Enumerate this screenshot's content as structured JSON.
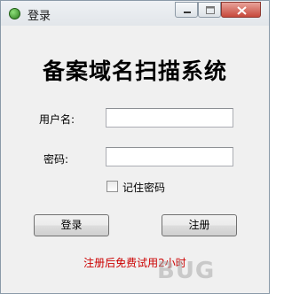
{
  "window": {
    "title": "登录",
    "icon": "app-icon-green-ball",
    "controls": [
      "minimize-icon",
      "maximize-icon",
      "close-icon"
    ]
  },
  "form": {
    "heading": "备案域名扫描系统",
    "username_label": "用户名:",
    "username_value": "",
    "password_label": "密码:",
    "password_value": "",
    "remember_label": "记住密码",
    "remember_checked": false,
    "login_button": "登录",
    "register_button": "注册",
    "notice": "注册后免费试用2小时",
    "notice_color": "#cc0000"
  },
  "watermark": "BUG"
}
